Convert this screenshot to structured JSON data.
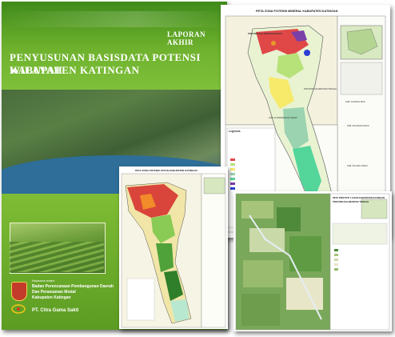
{
  "report": {
    "laporan": "LAPORAN AKHIR",
    "title_line1": "PENYUSUNAN BASISDATA POTENSI WILAYAH",
    "title_line2": "KABUPATEN KATINGAN",
    "kerjasama": "Kerjasama antara:",
    "badan_line1": "Badan Perencanaan Pembangunan Daerah",
    "badan_line2": "Dan Penanaman Modal",
    "badan_line3": "Kabupaten Katingan",
    "company": "PT. Citra Gama Sakti",
    "colors": {
      "cover_green": "#5c9a25",
      "sea_blue": "#2e6e98"
    }
  },
  "map_mineral": {
    "title": "PETA ZONA POTENSI MINERAL KABUPATEN KATINGAN",
    "province_label": "PROVINSI KALIMANTAN BARAT",
    "legend_title": "Legenda",
    "labels": [
      "PROVINSI KALIMANTAN TENGAH",
      "KAB. KOTAWARINGIN TIMUR",
      "KAB. GUNUNG MAS",
      "KAB. PULANG PISAU",
      "KAB. PALANGKA RAYA"
    ]
  },
  "map_forest": {
    "title": "PETA ZONA POTENSI HUTAN KABUPATEN KATINGAN"
  },
  "map_landcover": {
    "title_line1": "PETA PENUTUP LAHAN KABUPATEN KATINGAN",
    "title_line2": "PROVINSI KALIMANTAN TENGAH"
  }
}
